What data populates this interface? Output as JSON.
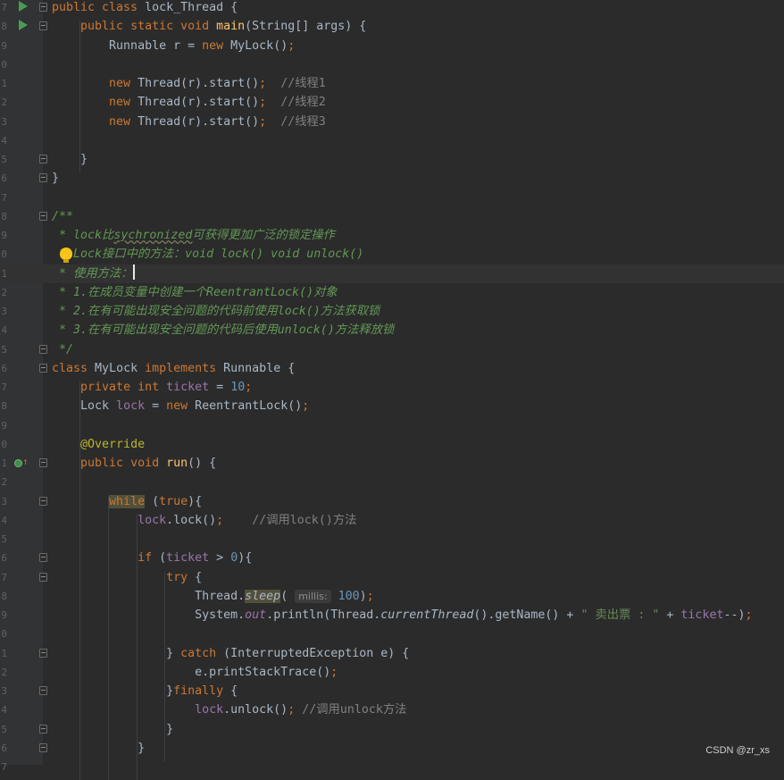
{
  "editor": {
    "lines": [
      {
        "num": "7",
        "marker": "run",
        "fold": true,
        "segments": [
          [
            "kw",
            "public class "
          ],
          [
            "p",
            "lock_Thread {"
          ]
        ]
      },
      {
        "num": "8",
        "marker": "run",
        "fold": true,
        "segments": [
          [
            "p",
            "    "
          ],
          [
            "kw",
            "public static void "
          ],
          [
            "fn",
            "main"
          ],
          [
            "p",
            "(String[] args) {"
          ]
        ]
      },
      {
        "num": "9",
        "segments": [
          [
            "p",
            "        Runnable r = "
          ],
          [
            "kw",
            "new "
          ],
          [
            "p",
            "MyLock()"
          ],
          [
            "kw",
            ";"
          ]
        ]
      },
      {
        "num": "0",
        "segments": []
      },
      {
        "num": "1",
        "segments": [
          [
            "p",
            "        "
          ],
          [
            "kw",
            "new "
          ],
          [
            "p",
            "Thread(r).start()"
          ],
          [
            "kw",
            ";  "
          ],
          [
            "cmt",
            "//线程1"
          ]
        ]
      },
      {
        "num": "2",
        "segments": [
          [
            "p",
            "        "
          ],
          [
            "kw",
            "new "
          ],
          [
            "p",
            "Thread(r).start()"
          ],
          [
            "kw",
            ";  "
          ],
          [
            "cmt",
            "//线程2"
          ]
        ]
      },
      {
        "num": "3",
        "segments": [
          [
            "p",
            "        "
          ],
          [
            "kw",
            "new "
          ],
          [
            "p",
            "Thread(r).start()"
          ],
          [
            "kw",
            ";  "
          ],
          [
            "cmt",
            "//线程3"
          ]
        ]
      },
      {
        "num": "4",
        "segments": []
      },
      {
        "num": "5",
        "fold": true,
        "segments": [
          [
            "p",
            "    }"
          ]
        ]
      },
      {
        "num": "6",
        "fold": true,
        "segments": [
          [
            "p",
            "}"
          ]
        ]
      },
      {
        "num": "7",
        "segments": []
      },
      {
        "num": "8",
        "fold": true,
        "segments": [
          [
            "doc",
            "/**"
          ]
        ]
      },
      {
        "num": "9",
        "segments": [
          [
            "doc",
            " * lock比"
          ],
          [
            "squig",
            "sychronized"
          ],
          [
            "doc",
            "可获得更加广泛的锁定操作"
          ]
        ]
      },
      {
        "num": "0",
        "bulb": true,
        "segments": [
          [
            "doc",
            " * Lock接口中的方法：void lock() void unlock()"
          ]
        ]
      },
      {
        "num": "1",
        "current": true,
        "segments": [
          [
            "doc",
            " * 使用方法："
          ],
          [
            "caret",
            ""
          ]
        ]
      },
      {
        "num": "2",
        "segments": [
          [
            "doc",
            " * 1.在成员变量中创建一个ReentrantLock()对象"
          ]
        ]
      },
      {
        "num": "3",
        "segments": [
          [
            "doc",
            " * 2.在有可能出现安全问题的代码前使用lock()方法获取锁"
          ]
        ]
      },
      {
        "num": "4",
        "segments": [
          [
            "doc",
            " * 3.在有可能出现安全问题的代码后使用unlock()方法释放锁"
          ]
        ]
      },
      {
        "num": "5",
        "fold": true,
        "segments": [
          [
            "doc",
            " */"
          ]
        ]
      },
      {
        "num": "6",
        "fold": true,
        "segments": [
          [
            "kw",
            "class "
          ],
          [
            "p",
            "MyLock "
          ],
          [
            "kw",
            "implements "
          ],
          [
            "p",
            "Runnable {"
          ]
        ]
      },
      {
        "num": "7",
        "segments": [
          [
            "p",
            "    "
          ],
          [
            "kw",
            "private int "
          ],
          [
            "fld",
            "ticket"
          ],
          [
            "p",
            " = "
          ],
          [
            "num",
            "10"
          ],
          [
            "kw",
            ";"
          ]
        ]
      },
      {
        "num": "8",
        "segments": [
          [
            "p",
            "    Lock "
          ],
          [
            "fld",
            "lock"
          ],
          [
            "p",
            " = "
          ],
          [
            "kw",
            "new "
          ],
          [
            "p",
            "ReentrantLock()"
          ],
          [
            "kw",
            ";"
          ]
        ]
      },
      {
        "num": "9",
        "segments": []
      },
      {
        "num": "0",
        "segments": [
          [
            "p",
            "    "
          ],
          [
            "ann",
            "@Override"
          ]
        ]
      },
      {
        "num": "1",
        "marker": "impl",
        "fold": true,
        "segments": [
          [
            "p",
            "    "
          ],
          [
            "kw",
            "public void "
          ],
          [
            "fn",
            "run"
          ],
          [
            "p",
            "() {"
          ]
        ]
      },
      {
        "num": "2",
        "segments": []
      },
      {
        "num": "3",
        "fold": true,
        "segments": [
          [
            "p",
            "        "
          ],
          [
            "kwhl",
            "while"
          ],
          [
            "p",
            " ("
          ],
          [
            "kw",
            "true"
          ],
          [
            "p",
            "){"
          ]
        ]
      },
      {
        "num": "4",
        "segments": [
          [
            "p",
            "            "
          ],
          [
            "fld",
            "lock"
          ],
          [
            "p",
            ".lock()"
          ],
          [
            "kw",
            ";    "
          ],
          [
            "cmt",
            "//调用lock()方法"
          ]
        ]
      },
      {
        "num": "5",
        "segments": []
      },
      {
        "num": "6",
        "fold": true,
        "segments": [
          [
            "p",
            "            "
          ],
          [
            "kw",
            "if "
          ],
          [
            "p",
            "("
          ],
          [
            "fld",
            "ticket"
          ],
          [
            "p",
            " > "
          ],
          [
            "num",
            "0"
          ],
          [
            "p",
            "){"
          ]
        ]
      },
      {
        "num": "7",
        "fold": true,
        "segments": [
          [
            "p",
            "                "
          ],
          [
            "kw",
            "try "
          ],
          [
            "p",
            "{"
          ]
        ]
      },
      {
        "num": "8",
        "segments": [
          [
            "p",
            "                    Thread."
          ],
          [
            "smethhl",
            "sleep"
          ],
          [
            "p",
            "( "
          ],
          [
            "hint",
            "millis:"
          ],
          [
            "p",
            " "
          ],
          [
            "num",
            "100"
          ],
          [
            "p",
            ")"
          ],
          [
            "kw",
            ";"
          ]
        ]
      },
      {
        "num": "9",
        "segments": [
          [
            "p",
            "                    System."
          ],
          [
            "sfld",
            "out"
          ],
          [
            "p",
            ".println(Thread."
          ],
          [
            "smeth",
            "currentThread"
          ],
          [
            "p",
            "().getName() + "
          ],
          [
            "str",
            "\" 卖出票 : \""
          ],
          [
            "p",
            " + "
          ],
          [
            "fld",
            "ticket"
          ],
          [
            "p",
            "--)"
          ],
          [
            "kw",
            ";"
          ]
        ]
      },
      {
        "num": "0",
        "segments": []
      },
      {
        "num": "1",
        "fold": true,
        "segments": [
          [
            "p",
            "                } "
          ],
          [
            "kw",
            "catch "
          ],
          [
            "p",
            "(InterruptedException e) {"
          ]
        ]
      },
      {
        "num": "2",
        "segments": [
          [
            "p",
            "                    e.printStackTrace()"
          ],
          [
            "kw",
            ";"
          ]
        ]
      },
      {
        "num": "3",
        "fold": true,
        "segments": [
          [
            "p",
            "                }"
          ],
          [
            "kw",
            "finally "
          ],
          [
            "p",
            "{"
          ]
        ]
      },
      {
        "num": "4",
        "segments": [
          [
            "p",
            "                    "
          ],
          [
            "fld",
            "lock"
          ],
          [
            "p",
            ".unlock()"
          ],
          [
            "kw",
            "; "
          ],
          [
            "cmt",
            "//调用unlock方法"
          ]
        ]
      },
      {
        "num": "5",
        "fold": true,
        "segments": [
          [
            "p",
            "                }"
          ]
        ]
      },
      {
        "num": "6",
        "fold": true,
        "segments": [
          [
            "p",
            "            }"
          ]
        ]
      },
      {
        "num": "7",
        "segments": []
      }
    ]
  },
  "watermark": "CSDN @zr_xs"
}
